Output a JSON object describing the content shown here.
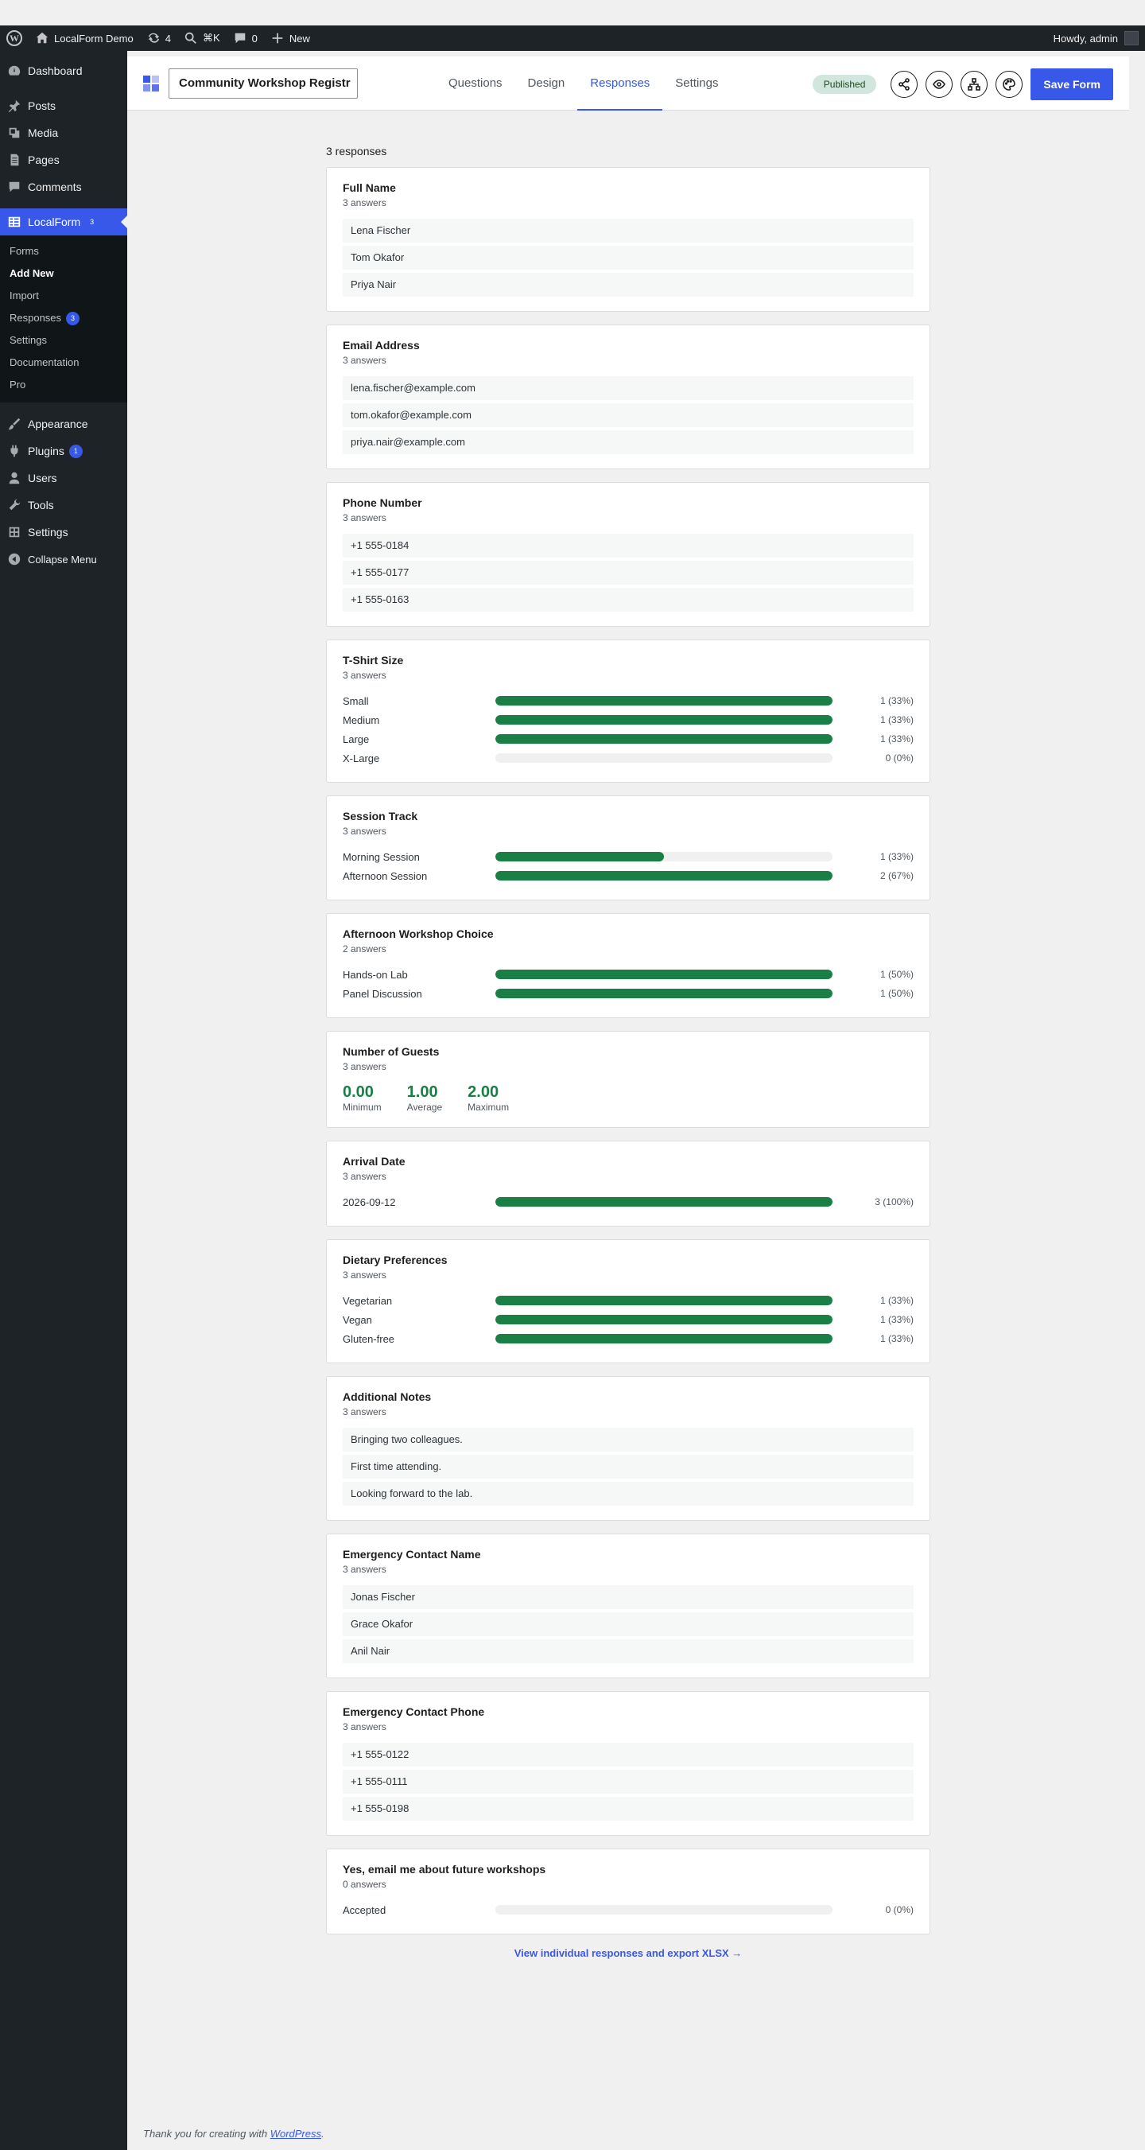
{
  "adminbar": {
    "site_name": "LocalForm Demo",
    "updates_count": "4",
    "search_shortcut": "⌘K",
    "comments_count": "0",
    "new_label": "New",
    "howdy": "Howdy, admin"
  },
  "sidebar": {
    "items_top": [
      {
        "label": "Dashboard",
        "icon": "dashboard-icon"
      }
    ],
    "items_mid": [
      {
        "label": "Posts",
        "icon": "pin-icon"
      },
      {
        "label": "Media",
        "icon": "media-icon"
      },
      {
        "label": "Pages",
        "icon": "pages-icon"
      },
      {
        "label": "Comments",
        "icon": "comment-icon"
      }
    ],
    "active": {
      "label": "LocalForm",
      "count": "3"
    },
    "submenu": [
      {
        "label": "Forms",
        "current": false,
        "count": ""
      },
      {
        "label": "Add New",
        "current": true,
        "count": ""
      },
      {
        "label": "Import",
        "current": false,
        "count": ""
      },
      {
        "label": "Responses",
        "current": false,
        "count": "3"
      },
      {
        "label": "Settings",
        "current": false,
        "count": ""
      },
      {
        "label": "Documentation",
        "current": false,
        "count": ""
      },
      {
        "label": "Pro",
        "current": false,
        "count": ""
      }
    ],
    "items_bottom": [
      {
        "label": "Appearance",
        "icon": "brush-icon",
        "count": ""
      },
      {
        "label": "Plugins",
        "icon": "plugin-icon",
        "count": "1"
      },
      {
        "label": "Users",
        "icon": "user-icon",
        "count": ""
      },
      {
        "label": "Tools",
        "icon": "wrench-icon",
        "count": ""
      },
      {
        "label": "Settings",
        "icon": "settings-icon",
        "count": ""
      },
      {
        "label": "Collapse Menu",
        "icon": "collapse-icon",
        "count": ""
      }
    ]
  },
  "header": {
    "form_title": "Community Workshop Registr",
    "tabs": [
      "Questions",
      "Design",
      "Responses",
      "Settings"
    ],
    "active_tab": "Responses",
    "status": "Published",
    "save_label": "Save Form"
  },
  "main": {
    "responses_count": "3 responses",
    "cards": [
      {
        "type": "text",
        "title": "Full Name",
        "sub": "3 answers",
        "answers": [
          "Lena Fischer",
          "Tom Okafor",
          "Priya Nair"
        ]
      },
      {
        "type": "text",
        "title": "Email Address",
        "sub": "3 answers",
        "answers": [
          "lena.fischer@example.com",
          "tom.okafor@example.com",
          "priya.nair@example.com"
        ]
      },
      {
        "type": "text",
        "title": "Phone Number",
        "sub": "3 answers",
        "answers": [
          "+1 555-0184",
          "+1 555-0177",
          "+1 555-0163"
        ]
      },
      {
        "type": "bars",
        "title": "T-Shirt Size",
        "sub": "3 answers",
        "rows": [
          {
            "label": "Small",
            "fill": 1.0,
            "value": "1 (33%)"
          },
          {
            "label": "Medium",
            "fill": 1.0,
            "value": "1 (33%)"
          },
          {
            "label": "Large",
            "fill": 1.0,
            "value": "1 (33%)"
          },
          {
            "label": "X-Large",
            "fill": 0.0,
            "value": "0 (0%)"
          }
        ]
      },
      {
        "type": "bars",
        "title": "Session Track",
        "sub": "3 answers",
        "rows": [
          {
            "label": "Morning Session",
            "fill": 0.5,
            "value": "1 (33%)"
          },
          {
            "label": "Afternoon Session",
            "fill": 1.0,
            "value": "2 (67%)"
          }
        ]
      },
      {
        "type": "bars",
        "title": "Afternoon Workshop Choice",
        "sub": "2 answers",
        "rows": [
          {
            "label": "Hands-on Lab",
            "fill": 1.0,
            "value": "1 (50%)"
          },
          {
            "label": "Panel Discussion",
            "fill": 1.0,
            "value": "1 (50%)"
          }
        ]
      },
      {
        "type": "stats",
        "title": "Number of Guests",
        "sub": "3 answers",
        "stats": [
          {
            "value": "0.00",
            "label": "Minimum"
          },
          {
            "value": "1.00",
            "label": "Average"
          },
          {
            "value": "2.00",
            "label": "Maximum"
          }
        ]
      },
      {
        "type": "bars",
        "title": "Arrival Date",
        "sub": "3 answers",
        "rows": [
          {
            "label": "2026-09-12",
            "fill": 1.0,
            "value": "3 (100%)"
          }
        ]
      },
      {
        "type": "bars",
        "title": "Dietary Preferences",
        "sub": "3 answers",
        "rows": [
          {
            "label": "Vegetarian",
            "fill": 1.0,
            "value": "1 (33%)"
          },
          {
            "label": "Vegan",
            "fill": 1.0,
            "value": "1 (33%)"
          },
          {
            "label": "Gluten-free",
            "fill": 1.0,
            "value": "1 (33%)"
          }
        ]
      },
      {
        "type": "text",
        "title": "Additional Notes",
        "sub": "3 answers",
        "answers": [
          "Bringing two colleagues.",
          "First time attending.",
          "Looking forward to the lab."
        ]
      },
      {
        "type": "text",
        "title": "Emergency Contact Name",
        "sub": "3 answers",
        "answers": [
          "Jonas Fischer",
          "Grace Okafor",
          "Anil Nair"
        ]
      },
      {
        "type": "text",
        "title": "Emergency Contact Phone",
        "sub": "3 answers",
        "answers": [
          "+1 555-0122",
          "+1 555-0111",
          "+1 555-0198"
        ]
      },
      {
        "type": "bars",
        "title": "Yes, email me about future workshops",
        "sub": "0 answers",
        "rows": [
          {
            "label": "Accepted",
            "fill": 0.0,
            "value": "0 (0%)"
          }
        ]
      }
    ],
    "bottom_link": "View individual responses and export XLSX →"
  },
  "footer": {
    "text": "Thank you for creating with ",
    "link": "WordPress",
    "end": "."
  },
  "colors": {
    "accent": "#3858e9",
    "bar_fill": "#1a7f44",
    "admin_dark": "#1d2327"
  }
}
